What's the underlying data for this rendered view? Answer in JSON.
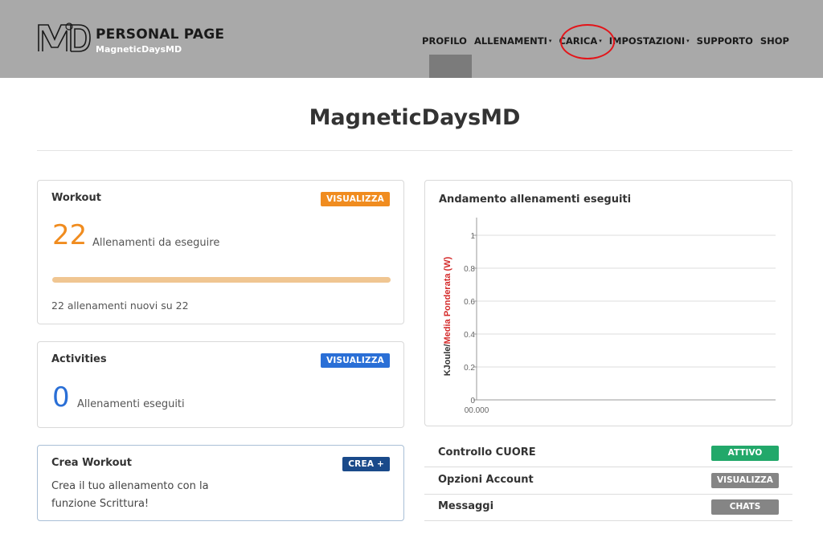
{
  "header": {
    "brand_title": "PERSONAL PAGE",
    "brand_subtitle": "MagneticDaysMD",
    "nav": [
      {
        "label": "PROFILO",
        "dropdown": false
      },
      {
        "label": "ALLENAMENTI",
        "dropdown": true
      },
      {
        "label": "CARICA",
        "dropdown": true
      },
      {
        "label": "IMPOSTAZIONI",
        "dropdown": true
      },
      {
        "label": "SUPPORTO",
        "dropdown": false
      },
      {
        "label": "SHOP",
        "dropdown": false
      }
    ],
    "caret": "▾"
  },
  "page_title": "MagneticDaysMD",
  "workout": {
    "title": "Workout",
    "button": "VISUALIZZA",
    "count": "22",
    "label": "Allenamenti da eseguire",
    "progress_percent": 100,
    "footer": "22 allenamenti nuovi su 22"
  },
  "activities": {
    "title": "Activities",
    "button": "VISUALIZZA",
    "count": "0",
    "label": "Allenamenti eseguiti"
  },
  "crea": {
    "title": "Crea Workout",
    "button": "CREA +",
    "text": "Crea il tuo allenamento con la funzione Scrittura!"
  },
  "chart_data": {
    "type": "line",
    "title": "Andamento allenamenti eseguiti",
    "ylabel_part1": "KJoule/",
    "ylabel_part2": "Media Ponderata (W)",
    "yticks": [
      "1",
      "0.8",
      "0.6",
      "0.4",
      "0.2",
      "0"
    ],
    "ylim": [
      0,
      1
    ],
    "x_tick": "00.000",
    "series": [],
    "grid": true
  },
  "list": [
    {
      "label": "Controllo CUORE",
      "button": "ATTIVO",
      "color": "#22a86a"
    },
    {
      "label": "Opzioni Account",
      "button": "VISUALIZZA",
      "color": "#858585"
    },
    {
      "label": "Messaggi",
      "button": "CHATS",
      "color": "#858585"
    }
  ],
  "colors": {
    "orange": "#f08c1f",
    "blue": "#2a6fd6",
    "dark_blue": "#1a4a8a",
    "header_bg": "#a9a9a9",
    "highlight_red": "#e3151a",
    "ylabel_red": "#d42a2a"
  }
}
